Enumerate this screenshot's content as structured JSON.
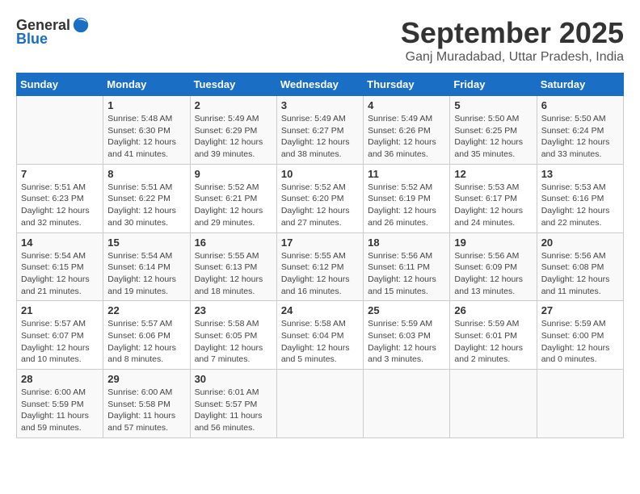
{
  "logo": {
    "general": "General",
    "blue": "Blue"
  },
  "title": "September 2025",
  "location": "Ganj Muradabad, Uttar Pradesh, India",
  "days_of_week": [
    "Sunday",
    "Monday",
    "Tuesday",
    "Wednesday",
    "Thursday",
    "Friday",
    "Saturday"
  ],
  "weeks": [
    [
      {
        "day": "",
        "info": ""
      },
      {
        "day": "1",
        "info": "Sunrise: 5:48 AM\nSunset: 6:30 PM\nDaylight: 12 hours\nand 41 minutes."
      },
      {
        "day": "2",
        "info": "Sunrise: 5:49 AM\nSunset: 6:29 PM\nDaylight: 12 hours\nand 39 minutes."
      },
      {
        "day": "3",
        "info": "Sunrise: 5:49 AM\nSunset: 6:27 PM\nDaylight: 12 hours\nand 38 minutes."
      },
      {
        "day": "4",
        "info": "Sunrise: 5:49 AM\nSunset: 6:26 PM\nDaylight: 12 hours\nand 36 minutes."
      },
      {
        "day": "5",
        "info": "Sunrise: 5:50 AM\nSunset: 6:25 PM\nDaylight: 12 hours\nand 35 minutes."
      },
      {
        "day": "6",
        "info": "Sunrise: 5:50 AM\nSunset: 6:24 PM\nDaylight: 12 hours\nand 33 minutes."
      }
    ],
    [
      {
        "day": "7",
        "info": "Sunrise: 5:51 AM\nSunset: 6:23 PM\nDaylight: 12 hours\nand 32 minutes."
      },
      {
        "day": "8",
        "info": "Sunrise: 5:51 AM\nSunset: 6:22 PM\nDaylight: 12 hours\nand 30 minutes."
      },
      {
        "day": "9",
        "info": "Sunrise: 5:52 AM\nSunset: 6:21 PM\nDaylight: 12 hours\nand 29 minutes."
      },
      {
        "day": "10",
        "info": "Sunrise: 5:52 AM\nSunset: 6:20 PM\nDaylight: 12 hours\nand 27 minutes."
      },
      {
        "day": "11",
        "info": "Sunrise: 5:52 AM\nSunset: 6:19 PM\nDaylight: 12 hours\nand 26 minutes."
      },
      {
        "day": "12",
        "info": "Sunrise: 5:53 AM\nSunset: 6:17 PM\nDaylight: 12 hours\nand 24 minutes."
      },
      {
        "day": "13",
        "info": "Sunrise: 5:53 AM\nSunset: 6:16 PM\nDaylight: 12 hours\nand 22 minutes."
      }
    ],
    [
      {
        "day": "14",
        "info": "Sunrise: 5:54 AM\nSunset: 6:15 PM\nDaylight: 12 hours\nand 21 minutes."
      },
      {
        "day": "15",
        "info": "Sunrise: 5:54 AM\nSunset: 6:14 PM\nDaylight: 12 hours\nand 19 minutes."
      },
      {
        "day": "16",
        "info": "Sunrise: 5:55 AM\nSunset: 6:13 PM\nDaylight: 12 hours\nand 18 minutes."
      },
      {
        "day": "17",
        "info": "Sunrise: 5:55 AM\nSunset: 6:12 PM\nDaylight: 12 hours\nand 16 minutes."
      },
      {
        "day": "18",
        "info": "Sunrise: 5:56 AM\nSunset: 6:11 PM\nDaylight: 12 hours\nand 15 minutes."
      },
      {
        "day": "19",
        "info": "Sunrise: 5:56 AM\nSunset: 6:09 PM\nDaylight: 12 hours\nand 13 minutes."
      },
      {
        "day": "20",
        "info": "Sunrise: 5:56 AM\nSunset: 6:08 PM\nDaylight: 12 hours\nand 11 minutes."
      }
    ],
    [
      {
        "day": "21",
        "info": "Sunrise: 5:57 AM\nSunset: 6:07 PM\nDaylight: 12 hours\nand 10 minutes."
      },
      {
        "day": "22",
        "info": "Sunrise: 5:57 AM\nSunset: 6:06 PM\nDaylight: 12 hours\nand 8 minutes."
      },
      {
        "day": "23",
        "info": "Sunrise: 5:58 AM\nSunset: 6:05 PM\nDaylight: 12 hours\nand 7 minutes."
      },
      {
        "day": "24",
        "info": "Sunrise: 5:58 AM\nSunset: 6:04 PM\nDaylight: 12 hours\nand 5 minutes."
      },
      {
        "day": "25",
        "info": "Sunrise: 5:59 AM\nSunset: 6:03 PM\nDaylight: 12 hours\nand 3 minutes."
      },
      {
        "day": "26",
        "info": "Sunrise: 5:59 AM\nSunset: 6:01 PM\nDaylight: 12 hours\nand 2 minutes."
      },
      {
        "day": "27",
        "info": "Sunrise: 5:59 AM\nSunset: 6:00 PM\nDaylight: 12 hours\nand 0 minutes."
      }
    ],
    [
      {
        "day": "28",
        "info": "Sunrise: 6:00 AM\nSunset: 5:59 PM\nDaylight: 11 hours\nand 59 minutes."
      },
      {
        "day": "29",
        "info": "Sunrise: 6:00 AM\nSunset: 5:58 PM\nDaylight: 11 hours\nand 57 minutes."
      },
      {
        "day": "30",
        "info": "Sunrise: 6:01 AM\nSunset: 5:57 PM\nDaylight: 11 hours\nand 56 minutes."
      },
      {
        "day": "",
        "info": ""
      },
      {
        "day": "",
        "info": ""
      },
      {
        "day": "",
        "info": ""
      },
      {
        "day": "",
        "info": ""
      }
    ]
  ]
}
